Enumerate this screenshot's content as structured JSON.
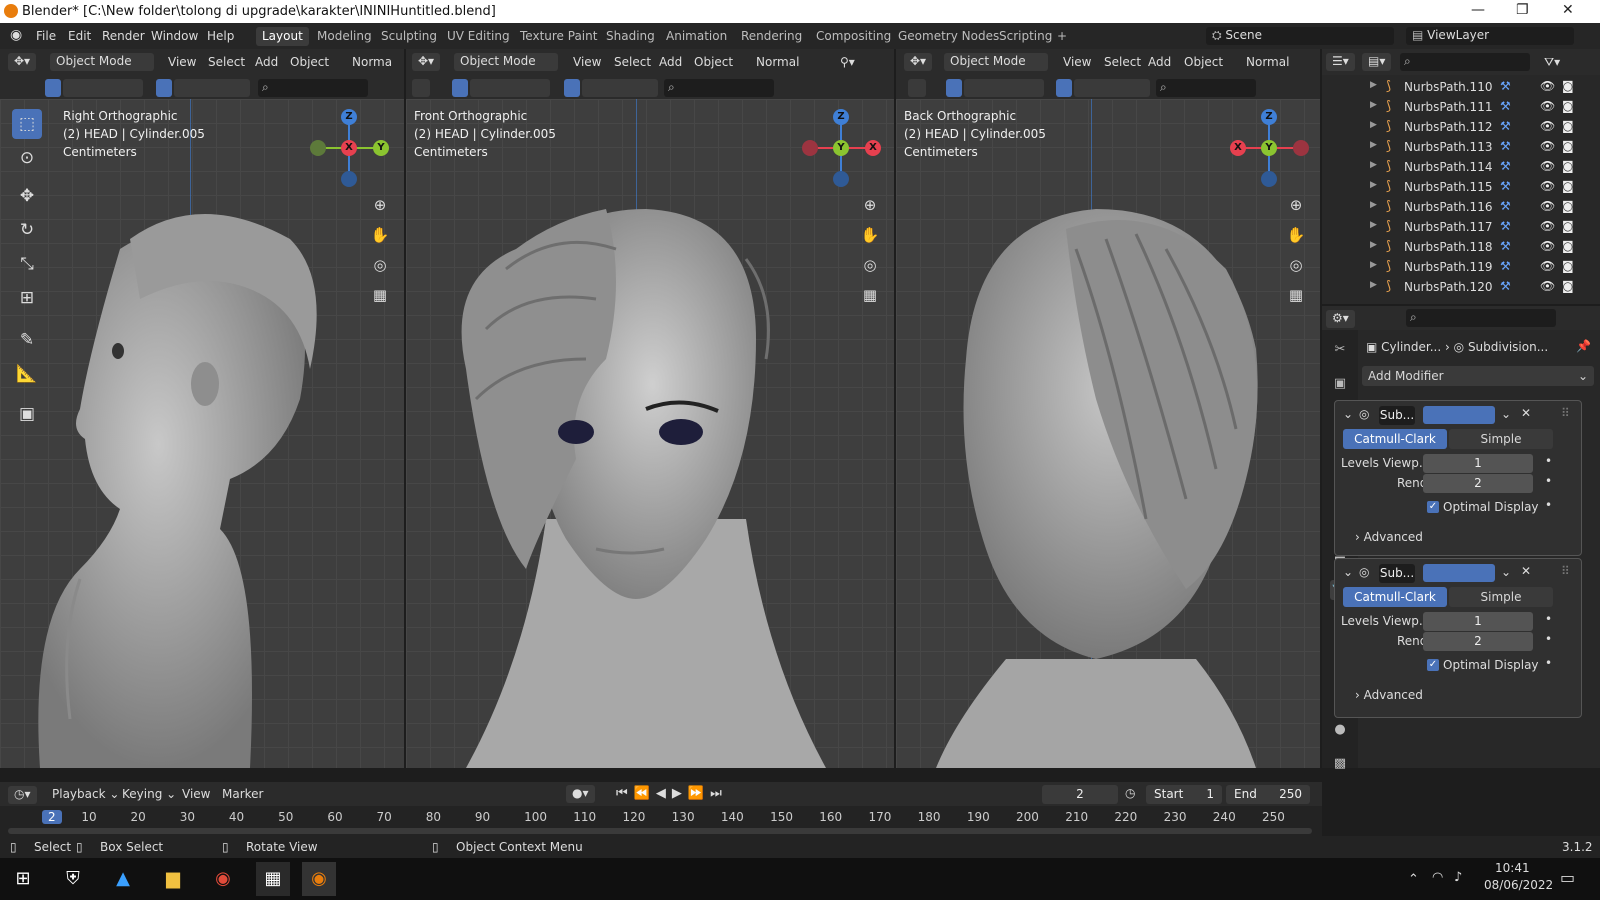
{
  "window": {
    "title": "Blender* [C:\\New folder\\tolong di upgrade\\karakter\\ININIHuntitled.blend]",
    "minimize": "—",
    "maximize": "❐",
    "close": "✕"
  },
  "menu": {
    "items": [
      "File",
      "Edit",
      "Render",
      "Window",
      "Help"
    ]
  },
  "workspaces": {
    "tabs": [
      "Layout",
      "Modeling",
      "Sculpting",
      "UV Editing",
      "Texture Paint",
      "Shading",
      "Animation",
      "Rendering",
      "Compositing",
      "Geometry Nodes",
      "Scripting"
    ],
    "add": "+",
    "active": "Layout"
  },
  "scene": {
    "label": "Scene",
    "viewlayer": "ViewLayer"
  },
  "viewports": [
    {
      "mode": "Object Mode",
      "view": "View",
      "select": "Select",
      "add": "Add",
      "object": "Object",
      "shading": "Norma",
      "title": "Right Orthographic",
      "collection": "(2) HEAD | Cylinder.005",
      "units": "Centimeters"
    },
    {
      "mode": "Object Mode",
      "view": "View",
      "select": "Select",
      "add": "Add",
      "object": "Object",
      "shading": "Normal",
      "title": "Front Orthographic",
      "collection": "(2) HEAD | Cylinder.005",
      "units": "Centimeters"
    },
    {
      "mode": "Object Mode",
      "view": "View",
      "select": "Select",
      "add": "Add",
      "object": "Object",
      "shading": "Normal",
      "title": "Back Orthographic",
      "collection": "(2) HEAD | Cylinder.005",
      "units": "Centimeters"
    }
  ],
  "gizmo_labels": {
    "z": "Z",
    "x": "X",
    "y": "Y"
  },
  "outliner": {
    "items": [
      "NurbsPath.110",
      "NurbsPath.111",
      "NurbsPath.112",
      "NurbsPath.113",
      "NurbsPath.114",
      "NurbsPath.115",
      "NurbsPath.116",
      "NurbsPath.117",
      "NurbsPath.118",
      "NurbsPath.119",
      "NurbsPath.120"
    ]
  },
  "properties": {
    "breadcrumb_object": "Cylinder...",
    "breadcrumb_modifier": "Subdivision...",
    "add_modifier": "Add Modifier",
    "modifiers": [
      {
        "name": "Sub...",
        "algo_a": "Catmull-Clark",
        "algo_b": "Simple",
        "levels_label": "Levels Viewp...",
        "levels_value": "1",
        "render_label": "Render",
        "render_value": "2",
        "optimal": "Optimal Display",
        "advanced": "Advanced"
      },
      {
        "name": "Sub...",
        "algo_a": "Catmull-Clark",
        "algo_b": "Simple",
        "levels_label": "Levels Viewp...",
        "levels_value": "1",
        "render_label": "Render",
        "render_value": "2",
        "optimal": "Optimal Display",
        "advanced": "Advanced"
      }
    ]
  },
  "timeline": {
    "playback": "Playback",
    "keying": "Keying",
    "view": "View",
    "marker": "Marker",
    "current_frame": "2",
    "start_label": "Start",
    "start": "1",
    "end_label": "End",
    "end": "250",
    "ticks": [
      "2",
      "10",
      "20",
      "30",
      "40",
      "50",
      "60",
      "70",
      "80",
      "90",
      "100",
      "110",
      "120",
      "130",
      "140",
      "150",
      "160",
      "170",
      "180",
      "190",
      "200",
      "210",
      "220",
      "230",
      "240",
      "250"
    ]
  },
  "statusbar": {
    "select": "Select",
    "box_select": "Box Select",
    "rotate": "Rotate View",
    "context": "Object Context Menu",
    "version": "3.1.2"
  },
  "taskbar": {
    "time": "10:41",
    "date": "08/06/2022"
  },
  "colors": {
    "accent": "#4a72b8",
    "x_axis": "#e6404f",
    "y_axis": "#8bc430",
    "z_axis": "#3f7fd6"
  }
}
